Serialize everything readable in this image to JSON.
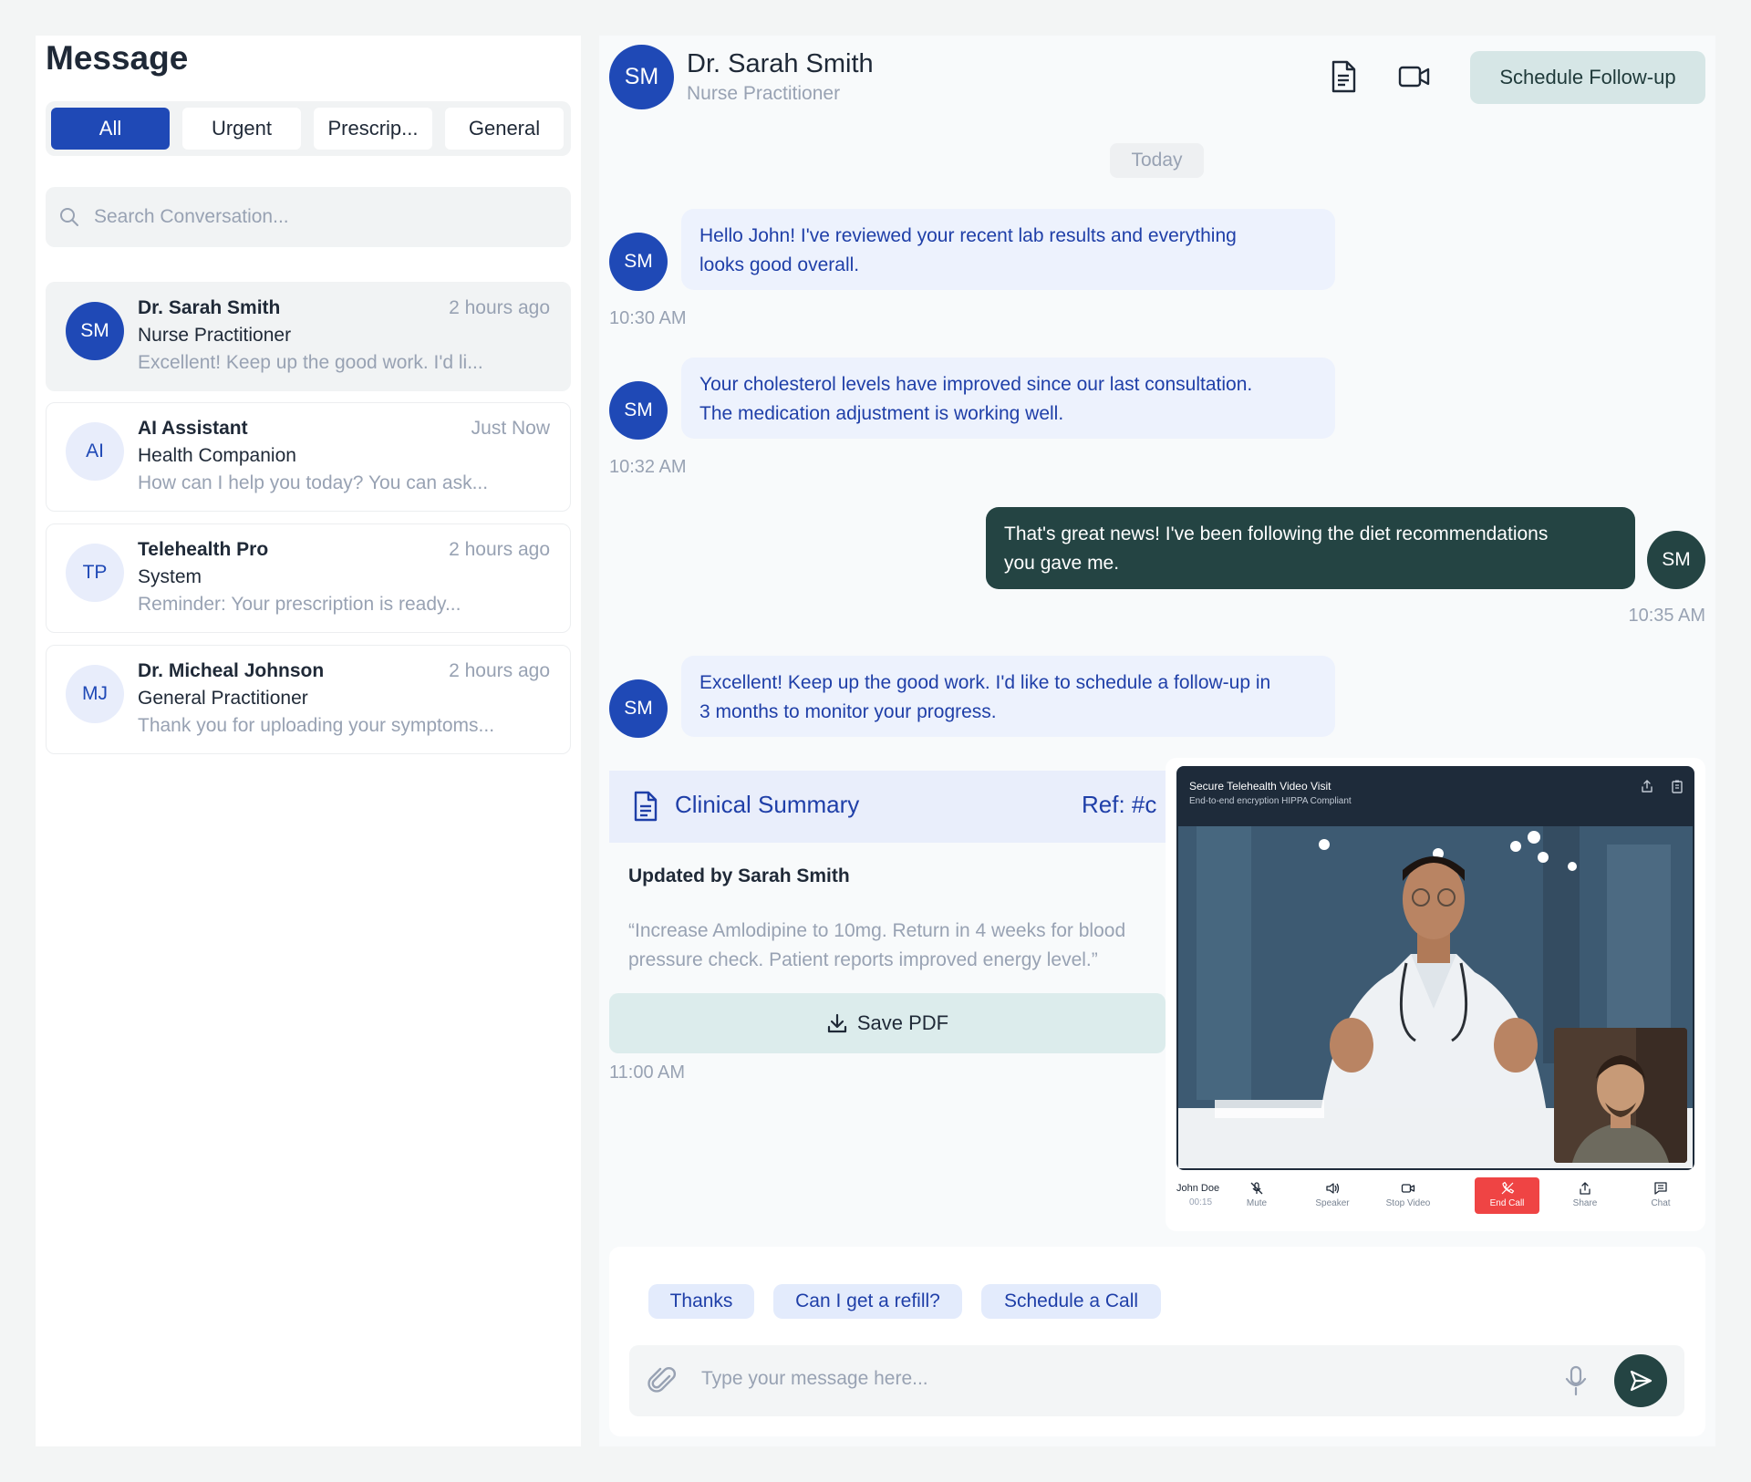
{
  "sidebar": {
    "title": "Message",
    "filters": [
      "All",
      "Urgent",
      "Prescrip...",
      "General"
    ],
    "search_placeholder": "Search Conversation...",
    "conversations": [
      {
        "initials": "SM",
        "name": "Dr. Sarah Smith",
        "role": "Nurse Practitioner",
        "preview": "Excellent! Keep up the good work. I'd li...",
        "time": "2 hours ago"
      },
      {
        "initials": "AI",
        "name": "AI Assistant",
        "role": "Health Companion",
        "preview": "How can I help you today? You can ask...",
        "time": "Just Now"
      },
      {
        "initials": "TP",
        "name": "Telehealth Pro",
        "role": "System",
        "preview": "Reminder: Your prescription is ready...",
        "time": "2 hours ago"
      },
      {
        "initials": "MJ",
        "name": "Dr. Micheal Johnson",
        "role": "General Practitioner",
        "preview": "Thank you for uploading your symptoms...",
        "time": "2 hours ago"
      }
    ]
  },
  "chat": {
    "header": {
      "initials": "SM",
      "name": "Dr. Sarah Smith",
      "role": "Nurse Practitioner",
      "followup_label": "Schedule Follow-up"
    },
    "day_label": "Today",
    "messages": [
      {
        "initials": "SM",
        "line1": "Hello John! I've reviewed your recent lab results and everything",
        "line2": "looks good overall.",
        "time": "10:30 AM"
      },
      {
        "initials": "SM",
        "line1": "Your cholesterol levels have improved since our last consultation.",
        "line2": "The medication adjustment is working well.",
        "time": "10:32 AM"
      },
      {
        "initials": "SM",
        "line1": "That's great news! I've been following the diet recommendations",
        "line2": "you gave me.",
        "time": "10:35 AM"
      },
      {
        "initials": "SM",
        "line1": "Excellent! Keep up the good work. I'd like to schedule a follow-up in",
        "line2": "3 months to monitor your progress.",
        "time": ""
      }
    ],
    "clinical": {
      "title": "Clinical Summary",
      "ref": "Ref: #c",
      "updated_by": "Updated by Sarah Smith",
      "line1": "“Increase Amlodipine to 10mg. Return in 4 weeks for blood",
      "line2": "pressure check. Patient reports improved energy level.”",
      "save_label": "Save PDF",
      "time": "11:00 AM"
    },
    "video": {
      "title": "Secure Telehealth Video Visit",
      "subtitle": "End-to-end encryption HIPPA Compliant",
      "caller_name": "John Doe",
      "caller_time": "00:15",
      "controls": {
        "mute": "Mute",
        "speaker": "Speaker",
        "stop_video": "Stop Video",
        "end_call": "End Call",
        "share": "Share",
        "chat": "Chat"
      }
    },
    "quick_replies": [
      "Thanks",
      "Can I get a refill?",
      "Schedule a Call"
    ],
    "input_placeholder": "Type your message here..."
  },
  "colors": {
    "primary": "#1f49b6",
    "dark_green": "#244443",
    "end_call": "#ef4444"
  }
}
